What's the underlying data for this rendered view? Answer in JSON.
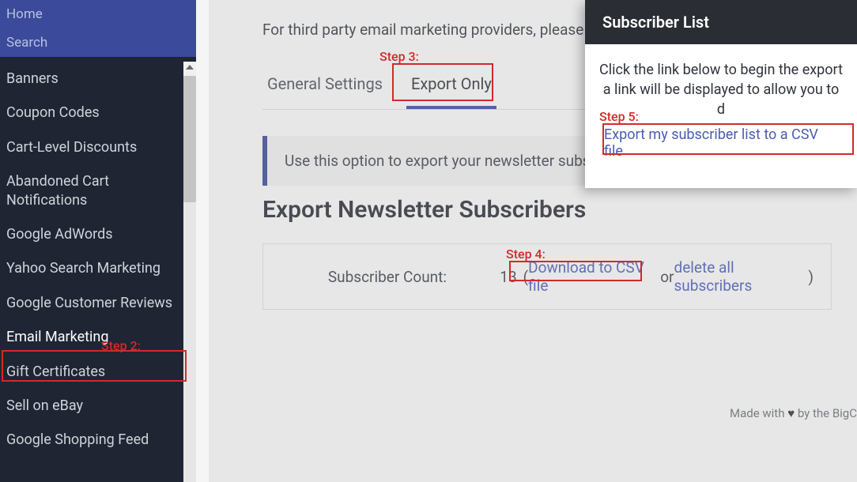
{
  "sidebar": {
    "home": "Home",
    "search": "Search",
    "items": [
      {
        "label": "Banners"
      },
      {
        "label": "Coupon Codes"
      },
      {
        "label": "Cart-Level Discounts"
      },
      {
        "label": "Abandoned Cart Notifications"
      },
      {
        "label": "Google AdWords"
      },
      {
        "label": "Yahoo Search Marketing"
      },
      {
        "label": "Google Customer Reviews"
      },
      {
        "label": "Email Marketing"
      },
      {
        "label": "Gift Certificates"
      },
      {
        "label": "Sell on eBay"
      },
      {
        "label": "Google Shopping Feed"
      }
    ]
  },
  "main": {
    "top_text": "For third party email marketing providers, please vis",
    "tabs": {
      "general": "General Settings",
      "export": "Export Only"
    },
    "info_text": "Use this option to export your newsletter subsc",
    "section_title": "Export Newsletter Subscribers",
    "subscriber_label": "Subscriber Count:",
    "subscriber_count": "13",
    "download_link": "Download to CSV file",
    "paren_open": "(",
    "or_text": " or ",
    "delete_link": "delete all subscribers",
    "paren_close": ")",
    "footer": "Made with ♥ by the BigC"
  },
  "panel": {
    "title": "Subscriber List",
    "text_line1": "Click the link below to begin the export",
    "text_line2": "a link will be displayed to allow you to d",
    "link": "Export my subscriber list to a CSV file"
  },
  "annotations": {
    "step2": "Step 2:",
    "step3": "Step 3:",
    "step4": "Step 4:",
    "step5": "Step 5:"
  }
}
